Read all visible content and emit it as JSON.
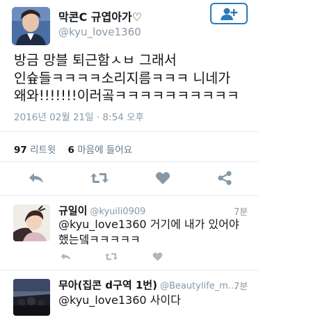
{
  "tweet": {
    "author_name": "막콘C 규엽아가♡",
    "author_handle": "@kyu_love1360",
    "text_lines": [
      "방금 망블 퇴근함ㅅㅂ 그래서",
      "인슢들ㅋㅋㅋㅋ소리지름ㅋㅋㅋ 니네가",
      "왜와!!!!!!!이러곸ㅋㅋㅋㅋㅋㅋㅋㅋㅋㅋ"
    ],
    "timestamp": "2016년 02월 21일 · 8:54 오후",
    "retweet_count": "97",
    "retweet_label": "리트윗",
    "like_count": "6",
    "like_label": "마음에 들어요",
    "icons": [
      "reply-icon",
      "retweet-icon",
      "heart-icon",
      "share-icon",
      "follow-icon"
    ],
    "accent_color": "#2b7bb9",
    "icon_color": "#8899a6"
  },
  "replies": [
    {
      "name": "규일이",
      "handle": "@kyuili0909",
      "time": "7분",
      "text_lines": [
        "@kyu_love1360 거기에 내가 있어야",
        "했는뎈ㅋㅋㅋㅋㅋ"
      ]
    },
    {
      "name": "무아(집콘 d구역 1번)",
      "handle": "@Beautylife_m...",
      "time": "7분",
      "text_lines": [
        "@kyu_love1360 사이다"
      ]
    }
  ]
}
